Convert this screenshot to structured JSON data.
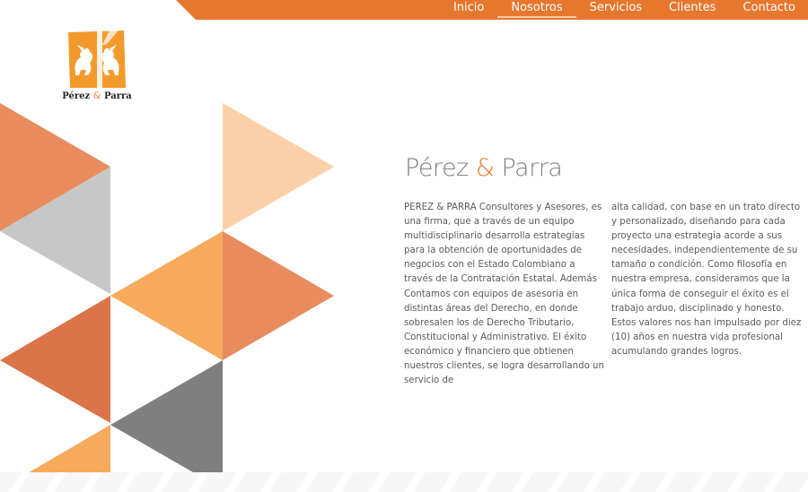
{
  "colors": {
    "accent": "#e8772e",
    "peach": "#fbcfa8",
    "salmon": "#e88c5e",
    "orange_light": "#f7a95c",
    "terracotta": "#dc7449",
    "gray_light": "#c7c7c7",
    "gray_dark": "#7f7f7f"
  },
  "nav": {
    "items": [
      {
        "label": "Inicio",
        "active": false
      },
      {
        "label": "Nosotros",
        "active": true
      },
      {
        "label": "Servicios",
        "active": false
      },
      {
        "label": "Clientes",
        "active": false
      },
      {
        "label": "Contacto",
        "active": false
      }
    ]
  },
  "logo": {
    "name_part1": "Pérez",
    "amp": "&",
    "name_part2": "Parra",
    "icon": "griffin-shield-icon"
  },
  "content": {
    "title_part1": "Pérez",
    "title_amp": "&",
    "title_part2": "Parra",
    "paragraph_col1": "PEREZ & PARRA Consultores y Asesores, es una firma, que a través de un equipo multidisciplinario desarrolla estrategias para la obtención de oportunidades de negocios con el Estado Colombiano a través de la Contratación Estatal. Además Contamos con equipos de asesoria en distintas áreas del Derecho, en donde sobresalen los de Derecho Tributario, Constitucional y Administrativo. El éxito económico y financiero que obtienen nuestros clientes, se logra desarrollando un servicio de",
    "paragraph_col2": "alta calidad, con base en un trato directo y personalizado, diseñando para cada proyecto una estrategia acorde a sus necesidades, independientemente de su tamaño o condición. Como filosofía en nuestra empresa, consideramos que la única forma de conseguir el éxito es el trabajo arduo, disciplinado y honesto. Estos valores nos han impulsado por diez (10) años en nuestra vida profesional acumulando grandes logros."
  }
}
